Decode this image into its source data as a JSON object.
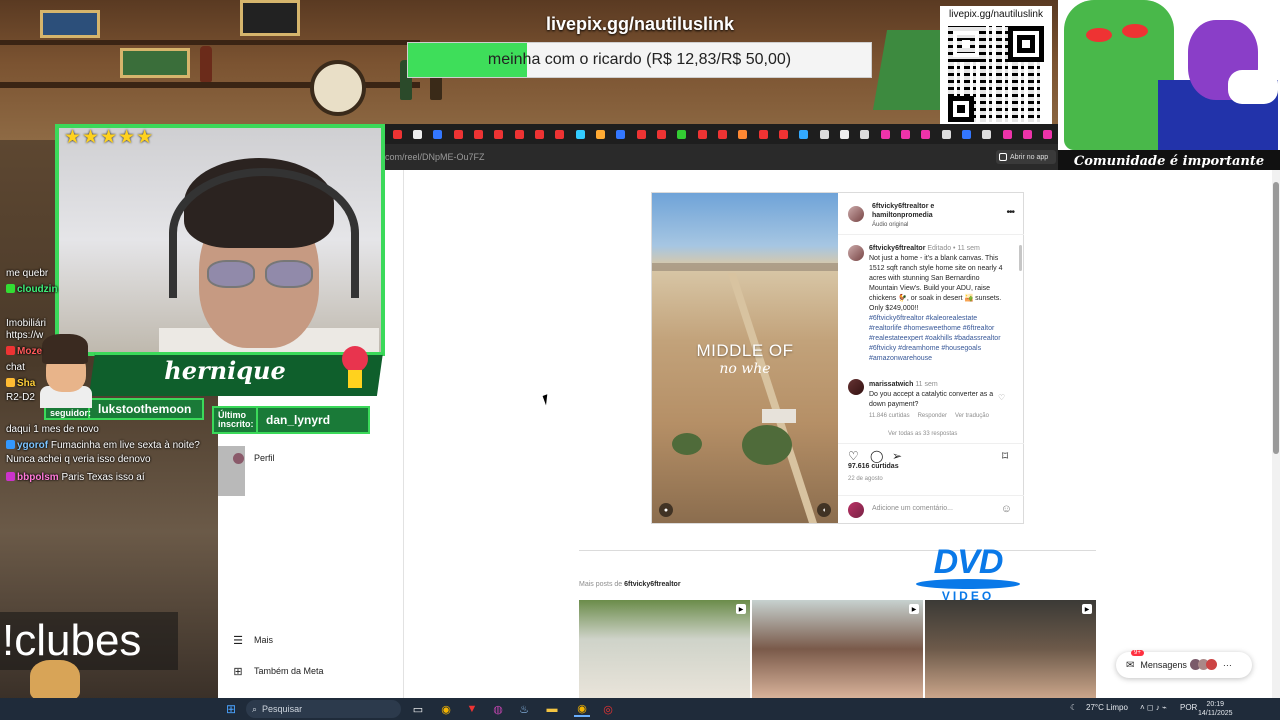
{
  "stream": {
    "donation_url": "livepix.gg/nautiluslink",
    "donation_goal_text": "meinha com o ricardo (R$ 12,83/R$ 50,00)",
    "donation_progress": 0.2566,
    "qr_url": "livepix.gg/nautiluslink",
    "cartoon_caption": "Comunidade é importante",
    "streamer_name": "hernique",
    "last_follower_label": "Último seguidor:",
    "last_follower": "lukstoothemoon",
    "last_sub_label": "Último inscrito:",
    "last_sub": "dan_lynyrd",
    "stars": "★★★★★",
    "command_overlay": "!clubes",
    "colors": {
      "accent_green": "#3bd95a",
      "plate_green": "#0f5f2c",
      "dvd_blue": "#0a79e8"
    }
  },
  "chat": [
    {
      "user": "",
      "text": "me quebr"
    },
    {
      "user": "cloudzin",
      "text": ""
    },
    {
      "user": "",
      "text": "Imobiliári"
    },
    {
      "user": "",
      "text": "https://w"
    },
    {
      "user": "Moze",
      "text": ""
    },
    {
      "user": "",
      "text": "chat"
    },
    {
      "user": "Sha",
      "text": ""
    },
    {
      "user": "",
      "text": "R2-D2"
    },
    {
      "user": "",
      "text": "daqui 1 mes de novo"
    },
    {
      "user": "ygorof",
      "text": "Fumacinha em live sexta à noite?"
    },
    {
      "user": "",
      "text": "Nunca achei q veria isso denovo"
    },
    {
      "user": "bbpolsm",
      "text": "Paris Texas isso aí"
    }
  ],
  "browser": {
    "url": "com/reel/DNpME-Ou7FZ",
    "open_app_label": "Abrir no app"
  },
  "instagram": {
    "nav": {
      "profile": "Perfil",
      "more": "Mais",
      "meta": "Também da Meta"
    },
    "post": {
      "authors": "6ftvicky6ftrealtor e",
      "coauthor": "hamiltonpromedia",
      "audio": "Áudio original",
      "caption_user": "6ftvicky6ftrealtor",
      "caption_meta": "Editado • 11 sem",
      "caption_text": "Not just a home - it's a blank canvas. This 1512 sqft ranch style home site on nearly 4 acres with stunning San Bernardino Mountain View's. Build your ADU, raise chickens 🐓, or soak in desert 🏜️ sunsets. Only $249,000!!",
      "caption_tags": "#6ftvicky6ftrealtor #kaleorealestate #realtorlife #homesweethome #6ftrealtor #realestateexpert #oakhills #badassrealtor #6ftvicky #dreamhome #housegoals #amazonwarehouse",
      "comment_user": "marissatwich",
      "comment_time": "11 sem",
      "comment_text": "Do you accept a catalytic converter as a down payment?",
      "comment_likes": "11.846 curtidas",
      "comment_reply": "Responder",
      "comment_translate": "Ver tradução",
      "more_replies": "Ver todas as 33 respostas",
      "likes": "97.616 curtidas",
      "date": "22 de agosto",
      "add_comment_placeholder": "Adicione um comentário...",
      "video_title": "MIDDLE OF",
      "video_subtitle": "no whe"
    },
    "more_posts_prefix": "Mais posts de ",
    "more_posts_user": "6ftvicky6ftrealtor",
    "messages_label": "Mensagens",
    "messages_badge": "9+"
  },
  "dvd": {
    "big": "DVD",
    "small": "VIDEO"
  },
  "taskbar": {
    "search_placeholder": "Pesquisar",
    "weather": "27°C Limpo",
    "lang": "POR",
    "time": "20:19",
    "date": "14/11/2025"
  }
}
